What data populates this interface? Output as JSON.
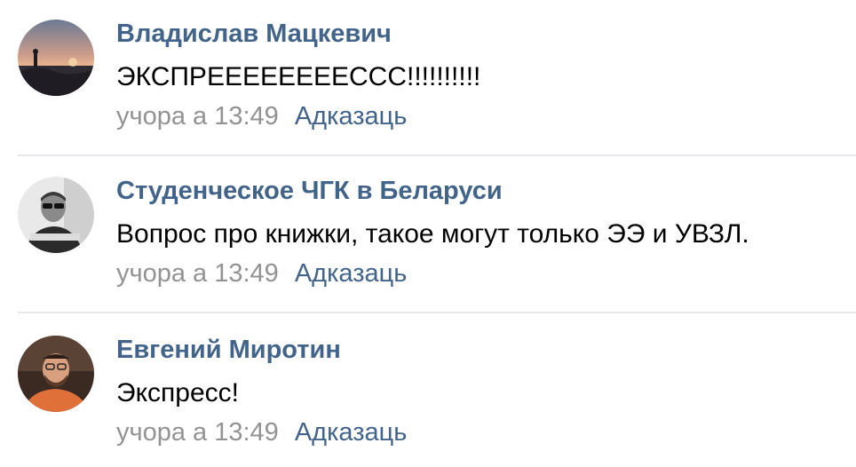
{
  "comments": [
    {
      "author": "Владислав Мацкевич",
      "text": "ЭКСПРЕЕЕЕЕЕЕЕССС!!!!!!!!!!",
      "date": "учора а 13:49",
      "reply_label": "Адказаць"
    },
    {
      "author": "Студенческое ЧГК в Беларуси",
      "text": "Вопрос про книжки, такое могут только ЭЭ и УВЗЛ.",
      "date": "учора а 13:49",
      "reply_label": "Адказаць"
    },
    {
      "author": "Евгений Миротин",
      "text": "Экспресс!",
      "date": "учора а 13:49",
      "reply_label": "Адказаць"
    }
  ],
  "colors": {
    "author_link": "#42648b",
    "reply_link": "#42648b",
    "date_text": "#939393",
    "comment_text": "#000000",
    "divider": "#e7e8ec"
  }
}
